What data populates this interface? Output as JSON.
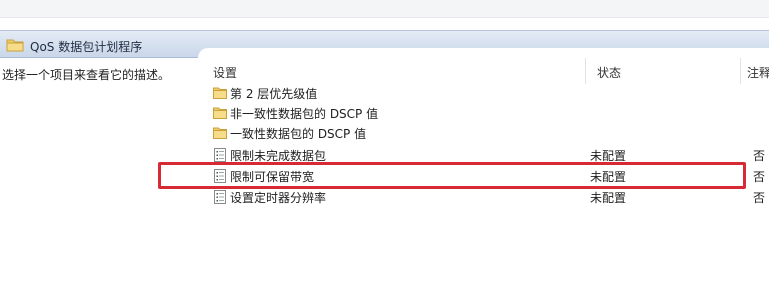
{
  "header": {
    "title": "QoS 数据包计划程序",
    "icon": "folder-icon"
  },
  "description": "选择一个项目来查看它的描述。",
  "columns": {
    "setting": "设置",
    "status": "状态",
    "comment": "注释"
  },
  "rows": [
    {
      "label": "第 2 层优先级值",
      "status": "",
      "comment": "",
      "icon": "folder-icon"
    },
    {
      "label": "非一致性数据包的 DSCP 值",
      "status": "",
      "comment": "",
      "icon": "folder-icon"
    },
    {
      "label": "一致性数据包的 DSCP 值",
      "status": "",
      "comment": "",
      "icon": "folder-icon"
    },
    {
      "label": "限制未完成数据包",
      "status": "未配置",
      "comment": "否",
      "icon": "policy-setting-icon"
    },
    {
      "label": "限制可保留带宽",
      "status": "未配置",
      "comment": "否",
      "icon": "policy-setting-icon"
    },
    {
      "label": "设置定时器分辨率",
      "status": "未配置",
      "comment": "否",
      "icon": "policy-setting-icon"
    }
  ],
  "highlight": {
    "color": "#d62b34",
    "target": "限制可保留带宽"
  }
}
